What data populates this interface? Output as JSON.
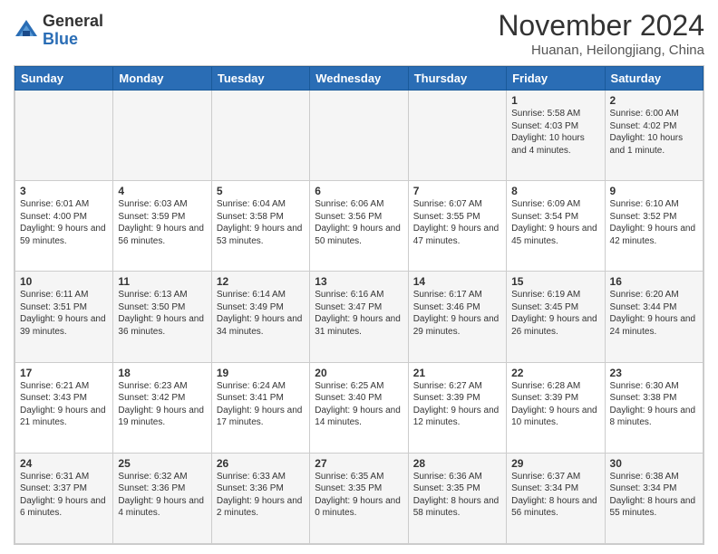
{
  "logo": {
    "general": "General",
    "blue": "Blue"
  },
  "header": {
    "month": "November 2024",
    "location": "Huanan, Heilongjiang, China"
  },
  "days": [
    "Sunday",
    "Monday",
    "Tuesday",
    "Wednesday",
    "Thursday",
    "Friday",
    "Saturday"
  ],
  "weeks": [
    [
      {
        "day": "",
        "info": ""
      },
      {
        "day": "",
        "info": ""
      },
      {
        "day": "",
        "info": ""
      },
      {
        "day": "",
        "info": ""
      },
      {
        "day": "",
        "info": ""
      },
      {
        "day": "1",
        "info": "Sunrise: 5:58 AM\nSunset: 4:03 PM\nDaylight: 10 hours\nand 4 minutes."
      },
      {
        "day": "2",
        "info": "Sunrise: 6:00 AM\nSunset: 4:02 PM\nDaylight: 10 hours\nand 1 minute."
      }
    ],
    [
      {
        "day": "3",
        "info": "Sunrise: 6:01 AM\nSunset: 4:00 PM\nDaylight: 9 hours\nand 59 minutes."
      },
      {
        "day": "4",
        "info": "Sunrise: 6:03 AM\nSunset: 3:59 PM\nDaylight: 9 hours\nand 56 minutes."
      },
      {
        "day": "5",
        "info": "Sunrise: 6:04 AM\nSunset: 3:58 PM\nDaylight: 9 hours\nand 53 minutes."
      },
      {
        "day": "6",
        "info": "Sunrise: 6:06 AM\nSunset: 3:56 PM\nDaylight: 9 hours\nand 50 minutes."
      },
      {
        "day": "7",
        "info": "Sunrise: 6:07 AM\nSunset: 3:55 PM\nDaylight: 9 hours\nand 47 minutes."
      },
      {
        "day": "8",
        "info": "Sunrise: 6:09 AM\nSunset: 3:54 PM\nDaylight: 9 hours\nand 45 minutes."
      },
      {
        "day": "9",
        "info": "Sunrise: 6:10 AM\nSunset: 3:52 PM\nDaylight: 9 hours\nand 42 minutes."
      }
    ],
    [
      {
        "day": "10",
        "info": "Sunrise: 6:11 AM\nSunset: 3:51 PM\nDaylight: 9 hours\nand 39 minutes."
      },
      {
        "day": "11",
        "info": "Sunrise: 6:13 AM\nSunset: 3:50 PM\nDaylight: 9 hours\nand 36 minutes."
      },
      {
        "day": "12",
        "info": "Sunrise: 6:14 AM\nSunset: 3:49 PM\nDaylight: 9 hours\nand 34 minutes."
      },
      {
        "day": "13",
        "info": "Sunrise: 6:16 AM\nSunset: 3:47 PM\nDaylight: 9 hours\nand 31 minutes."
      },
      {
        "day": "14",
        "info": "Sunrise: 6:17 AM\nSunset: 3:46 PM\nDaylight: 9 hours\nand 29 minutes."
      },
      {
        "day": "15",
        "info": "Sunrise: 6:19 AM\nSunset: 3:45 PM\nDaylight: 9 hours\nand 26 minutes."
      },
      {
        "day": "16",
        "info": "Sunrise: 6:20 AM\nSunset: 3:44 PM\nDaylight: 9 hours\nand 24 minutes."
      }
    ],
    [
      {
        "day": "17",
        "info": "Sunrise: 6:21 AM\nSunset: 3:43 PM\nDaylight: 9 hours\nand 21 minutes."
      },
      {
        "day": "18",
        "info": "Sunrise: 6:23 AM\nSunset: 3:42 PM\nDaylight: 9 hours\nand 19 minutes."
      },
      {
        "day": "19",
        "info": "Sunrise: 6:24 AM\nSunset: 3:41 PM\nDaylight: 9 hours\nand 17 minutes."
      },
      {
        "day": "20",
        "info": "Sunrise: 6:25 AM\nSunset: 3:40 PM\nDaylight: 9 hours\nand 14 minutes."
      },
      {
        "day": "21",
        "info": "Sunrise: 6:27 AM\nSunset: 3:39 PM\nDaylight: 9 hours\nand 12 minutes."
      },
      {
        "day": "22",
        "info": "Sunrise: 6:28 AM\nSunset: 3:39 PM\nDaylight: 9 hours\nand 10 minutes."
      },
      {
        "day": "23",
        "info": "Sunrise: 6:30 AM\nSunset: 3:38 PM\nDaylight: 9 hours\nand 8 minutes."
      }
    ],
    [
      {
        "day": "24",
        "info": "Sunrise: 6:31 AM\nSunset: 3:37 PM\nDaylight: 9 hours\nand 6 minutes."
      },
      {
        "day": "25",
        "info": "Sunrise: 6:32 AM\nSunset: 3:36 PM\nDaylight: 9 hours\nand 4 minutes."
      },
      {
        "day": "26",
        "info": "Sunrise: 6:33 AM\nSunset: 3:36 PM\nDaylight: 9 hours\nand 2 minutes."
      },
      {
        "day": "27",
        "info": "Sunrise: 6:35 AM\nSunset: 3:35 PM\nDaylight: 9 hours\nand 0 minutes."
      },
      {
        "day": "28",
        "info": "Sunrise: 6:36 AM\nSunset: 3:35 PM\nDaylight: 8 hours\nand 58 minutes."
      },
      {
        "day": "29",
        "info": "Sunrise: 6:37 AM\nSunset: 3:34 PM\nDaylight: 8 hours\nand 56 minutes."
      },
      {
        "day": "30",
        "info": "Sunrise: 6:38 AM\nSunset: 3:34 PM\nDaylight: 8 hours\nand 55 minutes."
      }
    ]
  ]
}
